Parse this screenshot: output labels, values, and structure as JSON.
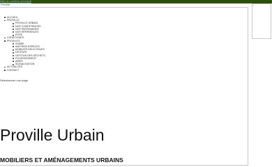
{
  "header": {
    "top_link": "Aller au contenu principal",
    "logo_alt": "Proville"
  },
  "menu": [
    {
      "label": "ACCUEIL",
      "level": 1
    },
    {
      "label": "PROVILLE",
      "level": 1
    },
    {
      "label": "PROVILLE URBAIN",
      "level": 2
    },
    {
      "label": "NOS COMPÉTENCES",
      "level": 2
    },
    {
      "label": "NOS PARTENAIRES",
      "level": 2
    },
    {
      "label": "NOS RÉFÉRENCES",
      "level": 2
    },
    {
      "label": "POSE",
      "level": 2
    },
    {
      "label": "CATALOGUES",
      "level": 1
    },
    {
      "label": "PRODUITS",
      "level": 1
    },
    {
      "label": "SOBRE",
      "level": 2
    },
    {
      "label": "MAÎTRISE ESPECES",
      "level": 2
    },
    {
      "label": "MOBILIER DEUX ROUES",
      "level": 2
    },
    {
      "label": "DÉTENTE",
      "level": 2
    },
    {
      "label": "GESTION DES DÉCHETS",
      "level": 2
    },
    {
      "label": "FLEURISSEMENT",
      "level": 2
    },
    {
      "label": "ABRIS",
      "level": 2
    },
    {
      "label": "SIGNALISATION",
      "level": 2
    },
    {
      "label": "ACTUALITÉS",
      "level": 1
    },
    {
      "label": "CONTACT",
      "level": 1
    }
  ],
  "page_select": {
    "label": "Sélectionner une page"
  },
  "hero": {
    "title": "Proville Urbain",
    "subtitle": "MOBILIERS ET AMÉNAGEMENTS URBAINS"
  },
  "colors": {
    "topbar": "#2f4f0c",
    "text": "#111111",
    "border": "#c8c8c8"
  }
}
